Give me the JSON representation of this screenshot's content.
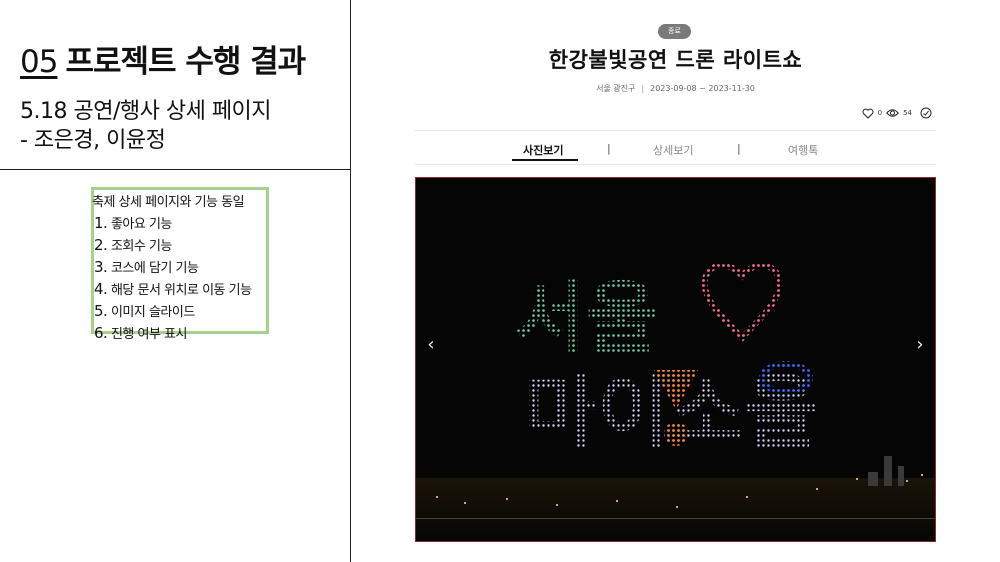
{
  "slide": {
    "section_number": "05",
    "section_title": "프로젝트 수행 결과",
    "subtitle_line1": "5.18 공연/행사 상세 페이지",
    "subtitle_line2": "- 조은경, 이윤정"
  },
  "note": {
    "heading": "축제 상세 페이지와 기능 동일",
    "items": [
      {
        "num": "1.",
        "text": "좋아요 기능"
      },
      {
        "num": "2.",
        "text": "조회수 기능"
      },
      {
        "num": "3.",
        "text": "코스에 담기 기능"
      },
      {
        "num": "4.",
        "text": "해당 문서 위치로 이동 기능"
      },
      {
        "num": "5.",
        "text": "이미지 슬라이드"
      },
      {
        "num": "6.",
        "text": "진행 여부 표시"
      }
    ],
    "border_color": "#a9d18e"
  },
  "detail": {
    "status_badge": "종료",
    "title": "한강불빛공연 드론 라이트쇼",
    "location": "서울 광진구",
    "period": "2023-09-08 ~ 2023-11-30",
    "likes": "0",
    "views": "54",
    "tabs": [
      "사진보기",
      "상세보기",
      "여행톡"
    ],
    "tab_separator": "|",
    "active_tab": "사진보기",
    "slide_prev": "‹",
    "slide_next": "›",
    "photo_text_line1": "서울",
    "photo_text_line2": "마이소울",
    "icons": [
      "heart-icon",
      "eye-icon",
      "share-icon",
      "chevron-left-icon",
      "chevron-right-icon"
    ]
  }
}
